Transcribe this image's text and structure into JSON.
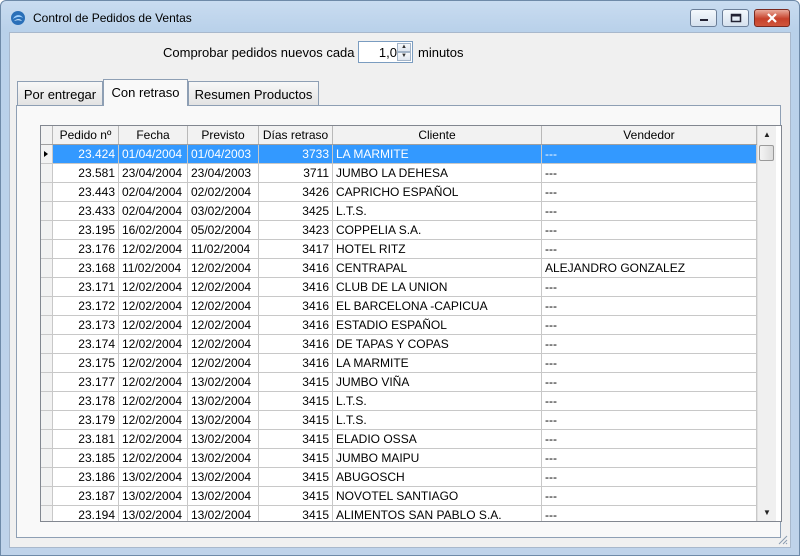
{
  "window": {
    "title": "Control de Pedidos de Ventas",
    "controls": {
      "minimize": "–",
      "maximize": "□",
      "close": "✕"
    }
  },
  "check": {
    "label_before": "Comprobar pedidos nuevos cada",
    "value": "1,0",
    "label_after": "minutos"
  },
  "tabs": [
    {
      "label": "Por entregar",
      "active": false
    },
    {
      "label": "Con retraso",
      "active": true
    },
    {
      "label": "Resumen Productos",
      "active": false
    }
  ],
  "grid": {
    "columns": [
      "Pedido nº",
      "Fecha",
      "Previsto",
      "Días retraso",
      "Cliente",
      "Vendedor"
    ],
    "rows": [
      [
        "23.424",
        "01/04/2004",
        "01/04/2003",
        "3733",
        "LA MARMITE",
        "---"
      ],
      [
        "23.581",
        "23/04/2004",
        "23/04/2003",
        "3711",
        "JUMBO LA DEHESA",
        "---"
      ],
      [
        "23.443",
        "02/04/2004",
        "02/02/2004",
        "3426",
        "CAPRICHO ESPAÑOL",
        "---"
      ],
      [
        "23.433",
        "02/04/2004",
        "03/02/2004",
        "3425",
        "L.T.S.",
        "---"
      ],
      [
        "23.195",
        "16/02/2004",
        "05/02/2004",
        "3423",
        "COPPELIA  S.A.",
        "---"
      ],
      [
        "23.176",
        "12/02/2004",
        "11/02/2004",
        "3417",
        "HOTEL RITZ",
        "---"
      ],
      [
        "23.168",
        "11/02/2004",
        "12/02/2004",
        "3416",
        "CENTRAPAL",
        "ALEJANDRO GONZALEZ"
      ],
      [
        "23.171",
        "12/02/2004",
        "12/02/2004",
        "3416",
        "CLUB DE LA UNION",
        "---"
      ],
      [
        "23.172",
        "12/02/2004",
        "12/02/2004",
        "3416",
        "EL BARCELONA -CAPICUA",
        "---"
      ],
      [
        "23.173",
        "12/02/2004",
        "12/02/2004",
        "3416",
        "ESTADIO ESPAÑOL",
        "---"
      ],
      [
        "23.174",
        "12/02/2004",
        "12/02/2004",
        "3416",
        "DE TAPAS Y COPAS",
        "---"
      ],
      [
        "23.175",
        "12/02/2004",
        "12/02/2004",
        "3416",
        "LA MARMITE",
        "---"
      ],
      [
        "23.177",
        "12/02/2004",
        "13/02/2004",
        "3415",
        "JUMBO VIÑA",
        "---"
      ],
      [
        "23.178",
        "12/02/2004",
        "13/02/2004",
        "3415",
        "L.T.S.",
        "---"
      ],
      [
        "23.179",
        "12/02/2004",
        "13/02/2004",
        "3415",
        "L.T.S.",
        "---"
      ],
      [
        "23.181",
        "12/02/2004",
        "13/02/2004",
        "3415",
        "ELADIO  OSSA",
        "---"
      ],
      [
        "23.185",
        "12/02/2004",
        "13/02/2004",
        "3415",
        "JUMBO MAIPU",
        "---"
      ],
      [
        "23.186",
        "13/02/2004",
        "13/02/2004",
        "3415",
        "ABUGOSCH",
        "---"
      ],
      [
        "23.187",
        "13/02/2004",
        "13/02/2004",
        "3415",
        "NOVOTEL SANTIAGO",
        "---"
      ],
      [
        "23.194",
        "13/02/2004",
        "13/02/2004",
        "3415",
        "ALIMENTOS SAN PABLO S.A.",
        "---"
      ]
    ],
    "selected_row": 0
  }
}
